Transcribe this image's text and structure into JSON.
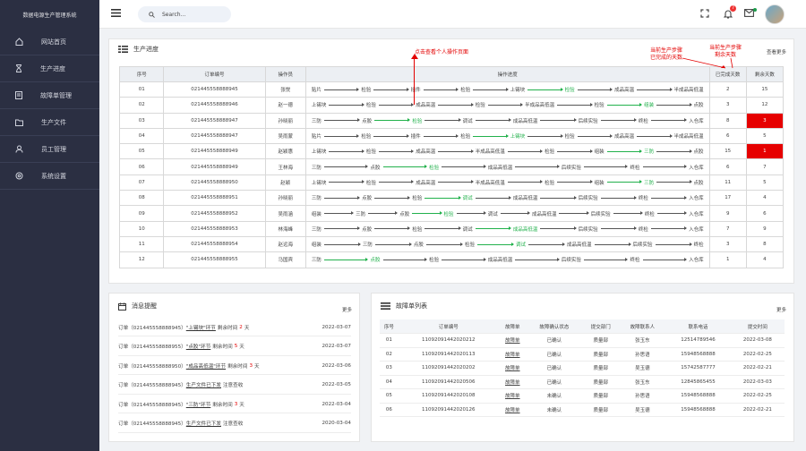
{
  "sidebar": {
    "brand": "数据电源生产管理系统",
    "items": [
      {
        "label": "网站首页",
        "icon": "home-icon"
      },
      {
        "label": "生产进度",
        "icon": "hourglass-icon"
      },
      {
        "label": "故障单管理",
        "icon": "document-icon"
      },
      {
        "label": "生产文件",
        "icon": "folder-icon"
      },
      {
        "label": "员工管理",
        "icon": "user-icon"
      },
      {
        "label": "系统设置",
        "icon": "settings-icon"
      }
    ]
  },
  "topbar": {
    "search_placeholder": "Search...",
    "notification_count": "7"
  },
  "production": {
    "title": "生产进度",
    "more": "查看更多",
    "headers": [
      "序号",
      "订单编号",
      "操作员",
      "操作进度",
      "已完成天数",
      "剩余天数"
    ],
    "annotations": {
      "operator": "点击查看个人操作页面",
      "completed": "当前生产步骤\n已完成的天数",
      "remaining": "当前生产步骤\n剩余天数"
    },
    "rows": [
      {
        "no": "01",
        "order": "021445558888945",
        "op": "张悦",
        "steps": [
          "贴片",
          "检验",
          "插件",
          "检验",
          "上锡块",
          "检验",
          "成品高温",
          "半成品高低温"
        ],
        "done": 5,
        "days": "2",
        "remain": "15",
        "alert": false
      },
      {
        "no": "02",
        "order": "021445558888946",
        "op": "赵一德",
        "steps": [
          "上锡块",
          "检验",
          "成品高温",
          "检验",
          "半成品高低温",
          "检验",
          "组装",
          "点胶"
        ],
        "done": 6,
        "days": "3",
        "remain": "12",
        "alert": false
      },
      {
        "no": "03",
        "order": "021445558888947",
        "op": "孙晓丽",
        "steps": [
          "三防",
          "点胶",
          "检验",
          "调试",
          "成品高低温",
          "后续实验",
          "终检",
          "入仓库"
        ],
        "done": 2,
        "days": "8",
        "remain": "3",
        "alert": true
      },
      {
        "no": "04",
        "order": "021445558888947",
        "op": "吴雨蒙",
        "steps": [
          "贴片",
          "检验",
          "插件",
          "检验",
          "上锡块",
          "检验",
          "成品高温",
          "半成品高低温"
        ],
        "done": 4,
        "days": "6",
        "remain": "5",
        "alert": false
      },
      {
        "no": "05",
        "order": "021445558888949",
        "op": "赵颖惠",
        "steps": [
          "上锡块",
          "检验",
          "成品高温",
          "半成品高低温",
          "检验",
          "组装",
          "三防",
          "点胶"
        ],
        "done": 6,
        "days": "15",
        "remain": "1",
        "alert": true
      },
      {
        "no": "06",
        "order": "021445558888949",
        "op": "王林海",
        "steps": [
          "三防",
          "点胶",
          "检验",
          "成品高低温",
          "后续实验",
          "终检",
          "入仓库"
        ],
        "done": 2,
        "days": "6",
        "remain": "7",
        "alert": false
      },
      {
        "no": "07",
        "order": "021445558888950",
        "op": "赵颖",
        "steps": [
          "上锡块",
          "检验",
          "成品高温",
          "半成品高低温",
          "检验",
          "组装",
          "三防",
          "点胶"
        ],
        "done": 6,
        "days": "11",
        "remain": "5",
        "alert": false
      },
      {
        "no": "08",
        "order": "021445558888951",
        "op": "孙晓丽",
        "steps": [
          "三防",
          "点胶",
          "检验",
          "调试",
          "成品高低温",
          "后续实验",
          "终检",
          "入仓库"
        ],
        "done": 3,
        "days": "17",
        "remain": "4",
        "alert": false
      },
      {
        "no": "09",
        "order": "021445558888952",
        "op": "吴雨涵",
        "steps": [
          "组装",
          "三防",
          "点胶",
          "检验",
          "调试",
          "成品高低温",
          "后续实验",
          "终检",
          "入仓库"
        ],
        "done": 3,
        "days": "9",
        "remain": "6",
        "alert": false
      },
      {
        "no": "10",
        "order": "021445558888953",
        "op": "林海峰",
        "steps": [
          "三防",
          "点胶",
          "检验",
          "调试",
          "成品高低温",
          "后续实验",
          "终检",
          "入仓库"
        ],
        "done": 4,
        "days": "7",
        "remain": "9",
        "alert": false
      },
      {
        "no": "11",
        "order": "021445558888954",
        "op": "赵远海",
        "steps": [
          "组装",
          "三防",
          "点胶",
          "检验",
          "调试",
          "成品高低温",
          "后续实验",
          "终检"
        ],
        "done": 4,
        "days": "3",
        "remain": "8",
        "alert": false
      },
      {
        "no": "12",
        "order": "021445558888955",
        "op": "马国宾",
        "steps": [
          "三防",
          "点胶",
          "检验",
          "成品高低温",
          "后续实验",
          "终检",
          "入仓库"
        ],
        "done": 1,
        "days": "1",
        "remain": "4",
        "alert": false
      }
    ]
  },
  "messages": {
    "title": "消息提醒",
    "more": "更多",
    "items": [
      {
        "pre": "订单（021445558888945）",
        "hl": "\"上锡块\"环节",
        "mid": "剩余时间",
        "num": "2",
        "unit": "天",
        "date": "2022-03-07"
      },
      {
        "pre": "订单（021445558888955）",
        "hl": "\"点胶\"环节",
        "mid": "剩余时间",
        "num": "5",
        "unit": "天",
        "date": "2022-03-07"
      },
      {
        "pre": "订单（021445558888950）",
        "hl": "\"成品高低温\"环节",
        "mid": "剩余时间",
        "num": "3",
        "unit": "天",
        "date": "2022-03-06"
      },
      {
        "pre": "订单（021445558888945）",
        "hl": "生产文件已下发",
        "mid": "注意查收",
        "num": "",
        "unit": "",
        "date": "2022-03-05"
      },
      {
        "pre": "订单（021445558888945）",
        "hl": "\"三防\"环节",
        "mid": "剩余时间",
        "num": "3",
        "unit": "天",
        "date": "2022-03-04"
      },
      {
        "pre": "订单（021445558888945）",
        "hl": "生产文件已下发",
        "mid": "注意查收",
        "num": "",
        "unit": "",
        "date": "2020-03-04"
      }
    ]
  },
  "faults": {
    "title": "故障单列表",
    "more": "更多",
    "headers": [
      "序号",
      "订单编号",
      "故障单",
      "故障确认状态",
      "提交部门",
      "故障联系人",
      "联系电话",
      "提交时间"
    ],
    "rows": [
      [
        "01",
        "11092091442020212",
        "故障单",
        "已确认",
        "质量部",
        "张玉东",
        "12514789546",
        "2022-03-08"
      ],
      [
        "02",
        "11092091442020113",
        "故障单",
        "已确认",
        "质量部",
        "孙思语",
        "15948568888",
        "2022-02-25"
      ],
      [
        "03",
        "11092091442020202",
        "故障单",
        "已确认",
        "质量部",
        "吴玉德",
        "15742587777",
        "2022-02-21"
      ],
      [
        "04",
        "11092091442020506",
        "故障单",
        "已确认",
        "质量部",
        "张玉东",
        "12845865455",
        "2022-03-03"
      ],
      [
        "05",
        "11092091442020108",
        "故障单",
        "未确认",
        "质量部",
        "孙思语",
        "15948568888",
        "2022-02-25"
      ],
      [
        "06",
        "11092091442020126",
        "故障单",
        "未确认",
        "质量部",
        "吴玉德",
        "15948568888",
        "2022-02-21"
      ]
    ]
  }
}
